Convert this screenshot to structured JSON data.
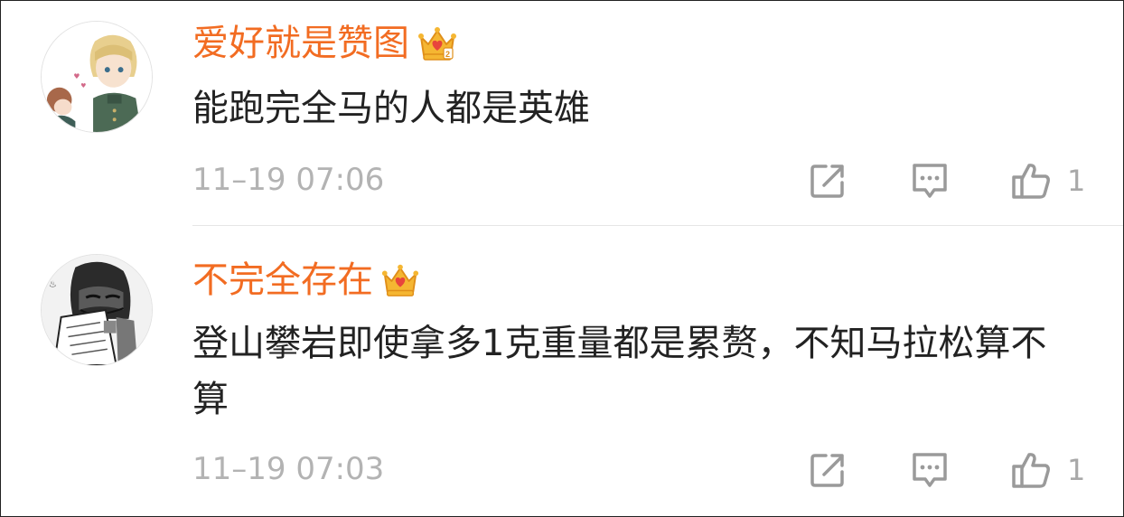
{
  "comments": [
    {
      "username": "爱好就是赞图",
      "text": "能跑完全马的人都是英雄",
      "time": "11–19 07:06",
      "likes": "1",
      "badge_icon": "crown-badge-icon",
      "avatar_icon": "anime-avatar"
    },
    {
      "username": "不完全存在",
      "text": "登山攀岩即使拿多1克重量都是累赘，不知马拉松算不算",
      "time": "11–19 07:03",
      "likes": "1",
      "badge_icon": "crown-badge-icon",
      "avatar_icon": "manga-avatar"
    }
  ],
  "colors": {
    "username": "#f26c22",
    "text": "#222222",
    "timestamp": "#b3b3b3",
    "icon": "#9a9a9a",
    "crown_gold": "#f5b632",
    "crown_red": "#e8453c"
  }
}
